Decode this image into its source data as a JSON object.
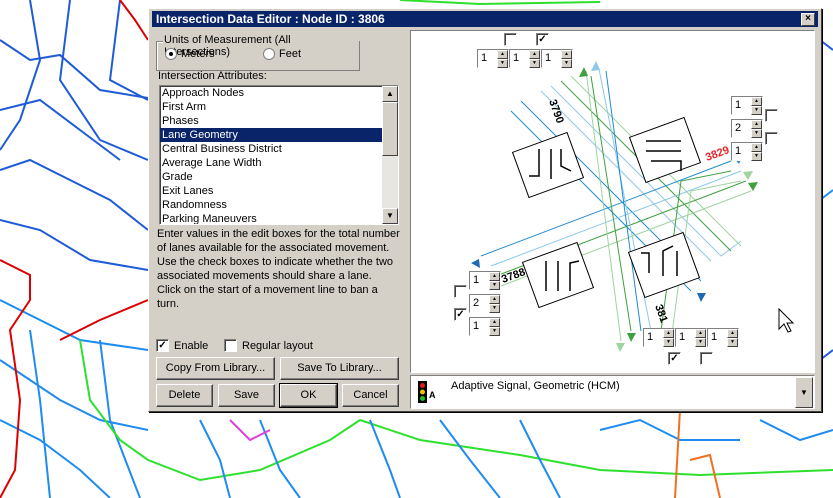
{
  "window": {
    "title": "Intersection Data Editor : Node ID : 3806",
    "close_glyph": "×"
  },
  "units": {
    "legend": "Units of Measurement (All Intersections)",
    "option_meters": "Meters",
    "option_feet": "Feet",
    "selected": "Meters"
  },
  "attributes": {
    "label": "Intersection Attributes:",
    "items": [
      "Approach Nodes",
      "First Arm",
      "Phases",
      "Lane Geometry",
      "Central Business District",
      "Average Lane Width",
      "Grade",
      "Exit Lanes",
      "Randomness",
      "Parking Maneuvers"
    ],
    "selected": "Lane Geometry"
  },
  "help_text": "Enter values in the edit boxes for the total number of lanes available for the associated movement. Use the check boxes to indicate whether the two associated movements should share a lane.\nClick on the start of a movement line to ban a turn.",
  "options": {
    "enable_label": "Enable",
    "enable_checked": true,
    "regular_layout_label": "Regular layout",
    "regular_layout_checked": false,
    "check_glyph": "✓"
  },
  "buttons": {
    "copy_from_library": "Copy From Library...",
    "save_to_library": "Save To Library...",
    "delete": "Delete",
    "save": "Save",
    "ok": "OK",
    "cancel": "Cancel"
  },
  "diagram": {
    "node_labels": {
      "north": "3790",
      "east": "3829",
      "west": "3788",
      "south": "381"
    },
    "top_spinners": [
      "1",
      "1",
      "1"
    ],
    "right_spinners": [
      "1",
      "2",
      "1"
    ],
    "left_spinners": [
      "1",
      "2",
      "1"
    ],
    "bottom_spinners": [
      "1",
      "1",
      "1"
    ],
    "top_checks": [
      false,
      true
    ],
    "right_checks": [
      false,
      false
    ],
    "left_checks": [
      false,
      true
    ],
    "bottom_checks": [
      true,
      false
    ]
  },
  "signal_control": {
    "value": "Adaptive Signal, Geometric (HCM)",
    "icon": "traffic-signal-icon"
  },
  "colors": {
    "title_bar": "#0a246a",
    "selection": "#0a246a",
    "node_label_east": "#e8262a"
  }
}
